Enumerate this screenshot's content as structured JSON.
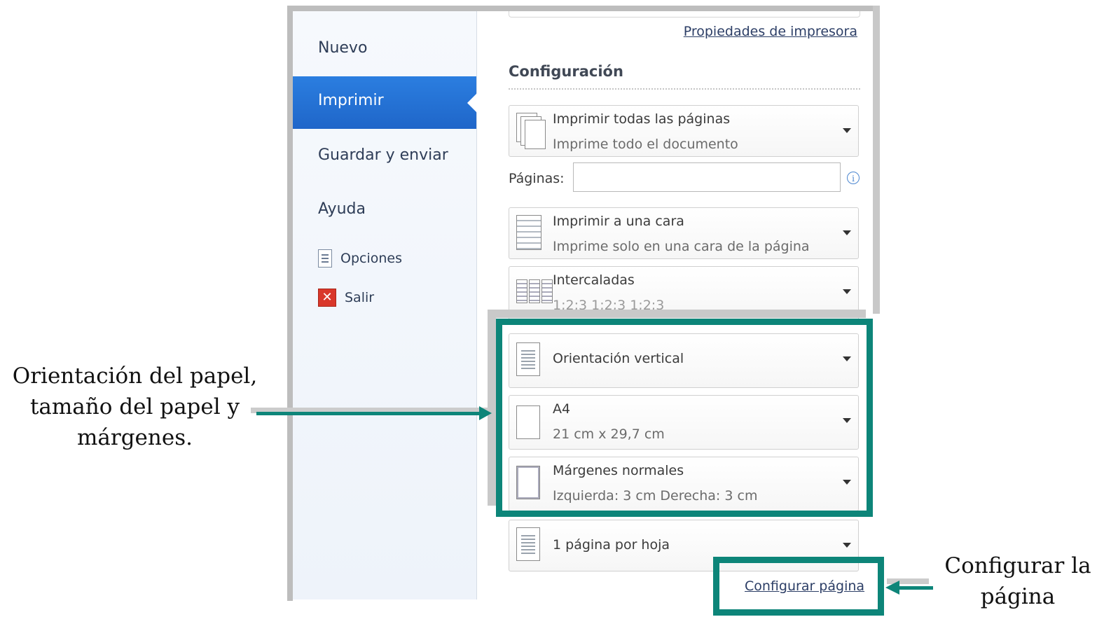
{
  "sidebar": {
    "items": [
      {
        "label": "Nuevo"
      },
      {
        "label": "Imprimir",
        "selected": true
      },
      {
        "label": "Guardar y enviar"
      },
      {
        "label": "Ayuda"
      },
      {
        "label": "Opciones",
        "icon": "options-icon"
      },
      {
        "label": "Salir",
        "icon": "exit-icon"
      }
    ]
  },
  "main": {
    "printer_properties_link": "Propiedades de impresora",
    "section_title": "Configuración",
    "pages_label": "Páginas:",
    "pages_value": "",
    "options": [
      {
        "title": "Imprimir todas las páginas",
        "subtitle": "Imprime todo el documento",
        "icon": "print-all-pages-icon"
      },
      {
        "title": "Imprimir a una cara",
        "subtitle": "Imprime solo en una cara de la página",
        "icon": "one-sided-icon"
      },
      {
        "title": "Intercaladas",
        "subtitle": "1;2;3    1;2;3    1;2;3",
        "icon": "collated-icon"
      },
      {
        "title": "Orientación vertical",
        "icon": "portrait-orientation-icon"
      },
      {
        "title": "A4",
        "subtitle": "21 cm x 29,7 cm",
        "icon": "paper-size-icon"
      },
      {
        "title": "Márgenes normales",
        "subtitle": "Izquierda:  3 cm     Derecha:  3 cm",
        "icon": "margins-icon"
      },
      {
        "title": "1 página por hoja",
        "icon": "pages-per-sheet-icon"
      }
    ],
    "page_setup_link": "Configurar página"
  },
  "annotations": {
    "left_note_lines": [
      "Orientación del papel,",
      "tamaño del papel y",
      "márgenes."
    ],
    "right_note_lines": [
      "Configurar la",
      "página"
    ],
    "highlight_color": "#0d8579"
  },
  "colors": {
    "selected_nav": "#1f66c9",
    "link": "#2c3e66"
  }
}
